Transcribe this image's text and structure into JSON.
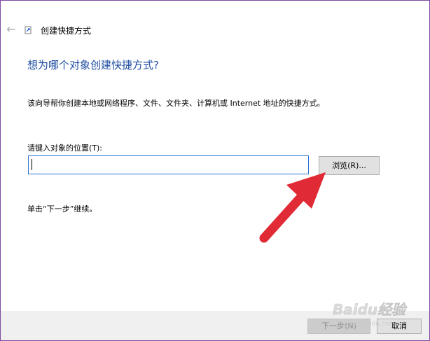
{
  "window": {
    "title": "创建快捷方式",
    "back_icon": "arrow-left-icon"
  },
  "main": {
    "heading": "想为哪个对象创建快捷方式?",
    "description": "该向导帮你创建本地或网络程序、文件、文件夹、计算机或 Internet 地址的快捷方式。",
    "location_label": "请键入对象的位置(T):",
    "location_value": "",
    "browse_label": "浏览(R)...",
    "hint": "单击“下一步”继续。"
  },
  "footer": {
    "next_label": "下一步(N)",
    "cancel_label": "取消"
  },
  "annotation": {
    "arrow_icon": "red-arrow-icon",
    "arrow_color": "#e02b36"
  },
  "watermark": {
    "text": "Baidu经验",
    "subtext": "jingyan.baidu.com"
  },
  "colors": {
    "heading": "#1f4ea1",
    "input_border": "#2a73d4",
    "footer_bg": "#f0f0f0",
    "window_border": "#7a4aa3"
  }
}
